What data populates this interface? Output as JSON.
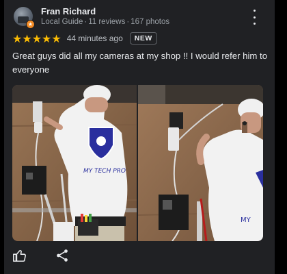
{
  "reviewer": {
    "name": "Fran Richard",
    "badge": "Local Guide",
    "reviews": "11 reviews",
    "photos": "167 photos",
    "separator": "·"
  },
  "rating": {
    "stars": 5,
    "stars_text": "★★★★★",
    "time": "44 minutes ago",
    "new_label": "NEW"
  },
  "review_text": "Great guys did all my cameras at my shop !! I would refer him to everyone",
  "photos": [
    {
      "shirt_logo_text": "MY TECH PRO"
    },
    {
      "shirt_logo_text": "MY"
    }
  ],
  "icons": {
    "menu": "more-vert-icon",
    "like": "thumb-up-icon",
    "share": "share-icon",
    "local_guide_badge": "local-guide-badge-icon"
  },
  "colors": {
    "card_bg": "#202124",
    "star": "#fbbc04",
    "badge_orange": "#f28b25",
    "logo_blue": "#2a2f9e"
  }
}
